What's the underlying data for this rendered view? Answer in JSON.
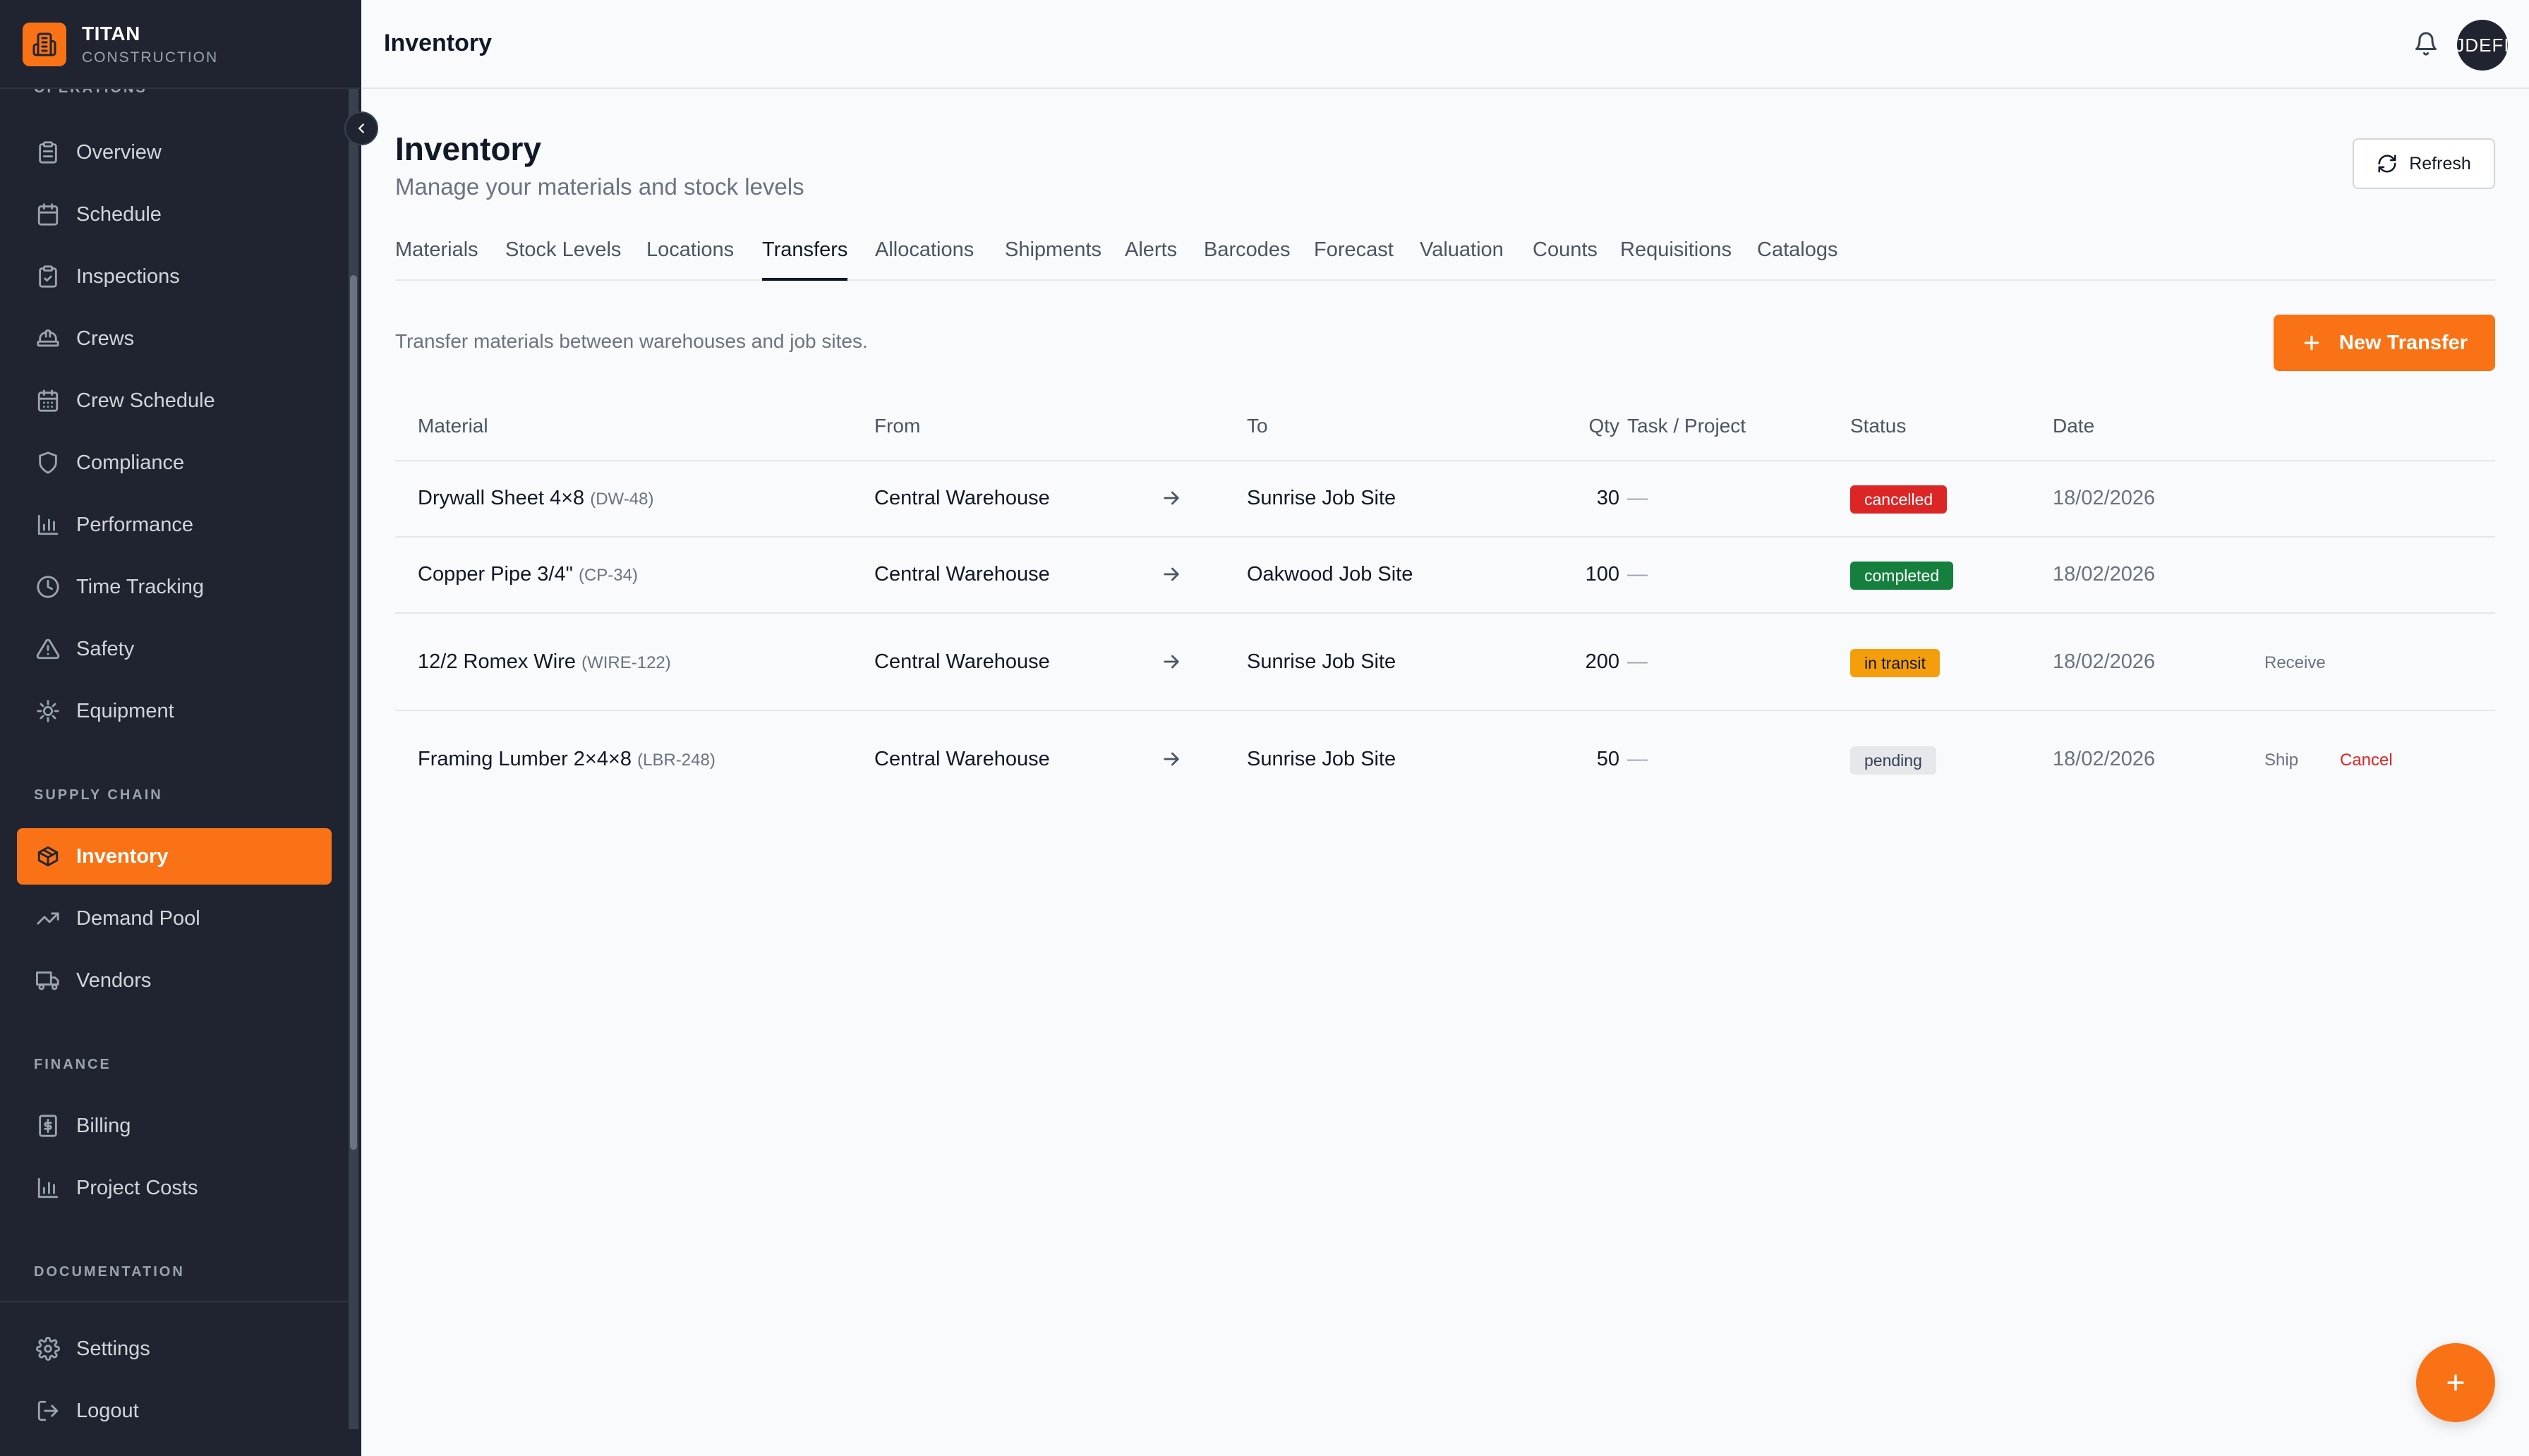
{
  "app": {
    "brand_title": "TITAN",
    "brand_subtitle": "CONSTRUCTION",
    "accent_color": "#f97316",
    "user_initials": "JDEFI"
  },
  "sidebar": {
    "sections": [
      {
        "label": "OPERATIONS",
        "items": [
          {
            "label": "Overview",
            "icon": "clipboard-icon"
          },
          {
            "label": "Schedule",
            "icon": "calendar-icon"
          },
          {
            "label": "Inspections",
            "icon": "clipboard-check-icon"
          },
          {
            "label": "Crews",
            "icon": "hard-hat-icon"
          },
          {
            "label": "Crew Schedule",
            "icon": "calendar-grid-icon"
          },
          {
            "label": "Compliance",
            "icon": "shield-icon"
          },
          {
            "label": "Performance",
            "icon": "bar-chart-icon"
          },
          {
            "label": "Time Tracking",
            "icon": "clock-icon"
          },
          {
            "label": "Safety",
            "icon": "warning-icon"
          },
          {
            "label": "Equipment",
            "icon": "cog-icon"
          }
        ]
      },
      {
        "label": "SUPPLY CHAIN",
        "items": [
          {
            "label": "Inventory",
            "icon": "package-icon",
            "active": true
          },
          {
            "label": "Demand Pool",
            "icon": "trending-up-icon"
          },
          {
            "label": "Vendors",
            "icon": "truck-icon"
          }
        ]
      },
      {
        "label": "FINANCE",
        "items": [
          {
            "label": "Billing",
            "icon": "receipt-icon"
          },
          {
            "label": "Project Costs",
            "icon": "bar-chart-icon"
          }
        ]
      },
      {
        "label": "DOCUMENTATION",
        "items": []
      }
    ],
    "footer": [
      {
        "label": "Settings",
        "icon": "gear-icon"
      },
      {
        "label": "Logout",
        "icon": "logout-icon"
      }
    ]
  },
  "topbar": {
    "title": "Inventory"
  },
  "page": {
    "title": "Inventory",
    "subtitle": "Manage your materials and stock levels",
    "refresh_label": "Refresh",
    "tabs": [
      "Materials",
      "Stock Levels",
      "Locations",
      "Transfers",
      "Allocations",
      "Shipments",
      "Alerts",
      "Barcodes",
      "Forecast",
      "Valuation",
      "Counts",
      "Requisitions",
      "Catalogs"
    ],
    "active_tab": "Transfers",
    "description": "Transfer materials between warehouses and job sites.",
    "new_button": "New Transfer"
  },
  "table": {
    "headers": [
      "Material",
      "From",
      "To",
      "Qty",
      "Task / Project",
      "Status",
      "Date"
    ],
    "rows": [
      {
        "material": "Drywall Sheet 4×8",
        "code": "(DW-48)",
        "from": "Central Warehouse",
        "to": "Sunrise Job Site",
        "qty": "30",
        "task": "—",
        "status": "cancelled",
        "date": "18/02/2026",
        "actions": []
      },
      {
        "material": "Copper Pipe 3/4\"",
        "code": "(CP-34)",
        "from": "Central Warehouse",
        "to": "Oakwood Job Site",
        "qty": "100",
        "task": "—",
        "status": "completed",
        "date": "18/02/2026",
        "actions": []
      },
      {
        "material": "12/2 Romex Wire",
        "code": "(WIRE-122)",
        "from": "Central Warehouse",
        "to": "Sunrise Job Site",
        "qty": "200",
        "task": "—",
        "status": "in transit",
        "date": "18/02/2026",
        "actions": [
          "Receive"
        ]
      },
      {
        "material": "Framing Lumber 2×4×8",
        "code": "(LBR-248)",
        "from": "Central Warehouse",
        "to": "Sunrise Job Site",
        "qty": "50",
        "task": "—",
        "status": "pending",
        "date": "18/02/2026",
        "actions": [
          "Ship",
          "Cancel"
        ]
      }
    ],
    "status_colors": {
      "cancelled": {
        "bg": "#dc2626",
        "fg": "#ffffff"
      },
      "completed": {
        "bg": "#15803d",
        "fg": "#ffffff"
      },
      "in transit": {
        "bg": "#f59e0b",
        "fg": "#111827"
      },
      "pending": {
        "bg": "#e5e7eb",
        "fg": "#374151"
      }
    }
  }
}
